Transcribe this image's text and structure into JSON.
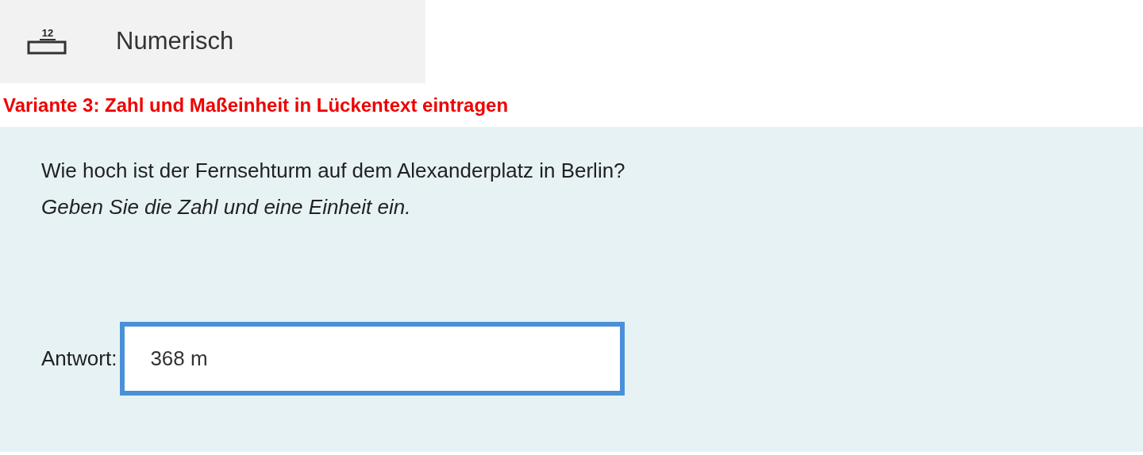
{
  "option": {
    "icon_label": "12",
    "label": "Numerisch"
  },
  "heading": "Variante 3: Zahl und Maßeinheit in Lückentext eintragen",
  "question": {
    "text": "Wie hoch ist der Fernsehturm auf dem Alexanderplatz in Berlin?",
    "hint": "Geben Sie die Zahl und eine Einheit ein.",
    "answer_label": "Antwort:",
    "answer_value": "368 m"
  }
}
